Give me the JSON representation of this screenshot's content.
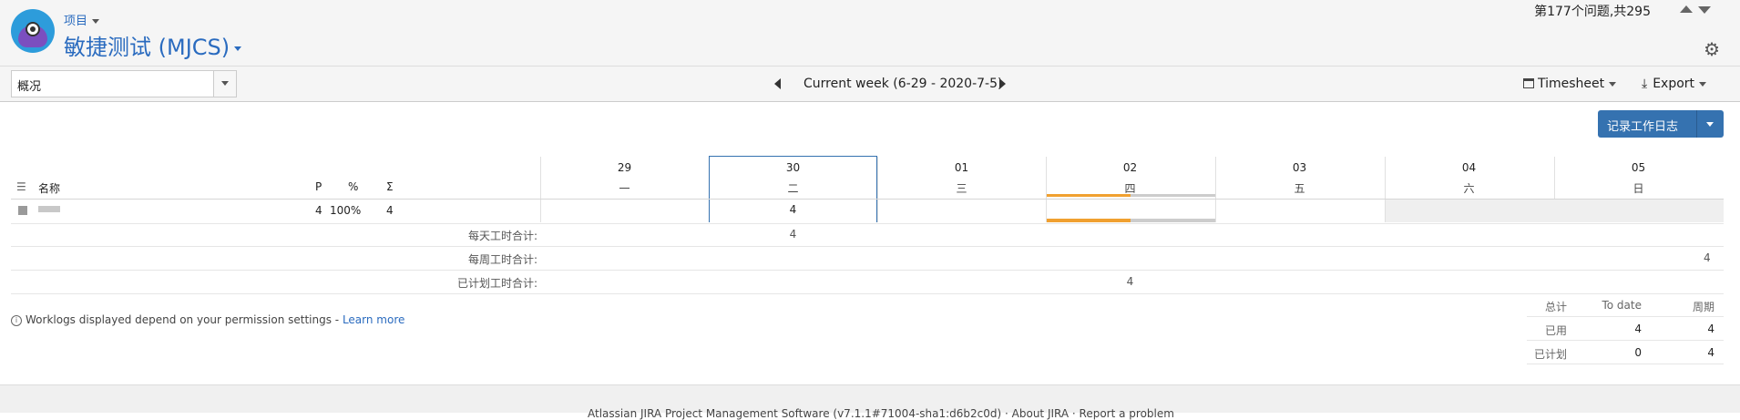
{
  "header": {
    "project_menu_label": "项目",
    "project_title": "敏捷测试 (MJCS)",
    "issue_counter": "第177个问题,共295"
  },
  "toolbar": {
    "view_select_value": "概况",
    "week_label": "Current week (6-29 - 2020-7-5)",
    "timesheet_label": "Timesheet",
    "export_label": "Export"
  },
  "actions": {
    "log_work_label": "记录工作日志"
  },
  "grid": {
    "headers": {
      "name": "名称",
      "p": "P",
      "percent": "%",
      "sigma": "Σ"
    },
    "days": [
      {
        "num": "29",
        "weekday": "一"
      },
      {
        "num": "30",
        "weekday": "二"
      },
      {
        "num": "01",
        "weekday": "三"
      },
      {
        "num": "02",
        "weekday": "四"
      },
      {
        "num": "03",
        "weekday": "五"
      },
      {
        "num": "04",
        "weekday": "六"
      },
      {
        "num": "05",
        "weekday": "日"
      }
    ],
    "row": {
      "p": "4",
      "percent": "100%",
      "sigma": "4",
      "day30": "4"
    },
    "summaries": {
      "daily_label": "每天工时合计:",
      "daily_value": "4",
      "weekly_label": "每周工时合计:",
      "weekly_value": "4",
      "planned_label": "已计划工时合计:",
      "planned_value": "4"
    }
  },
  "footnote": {
    "text": "Worklogs displayed depend on your permission settings - ",
    "link": "Learn more"
  },
  "totals": {
    "headers": [
      "总计",
      "To date",
      "周期"
    ],
    "rows": [
      {
        "label": "已用",
        "to_date": "4",
        "period": "4"
      },
      {
        "label": "已计划",
        "to_date": "0",
        "period": "4"
      }
    ]
  },
  "footer": {
    "text": "Atlassian JIRA Project Management Software (v7.1.1#71004-sha1:d6b2c0d) · About JIRA · Report a problem"
  },
  "colors": {
    "accent": "#3572b0",
    "link": "#2a6bbf",
    "plan_bar": "#f0a030",
    "today_border": "#3572b0"
  }
}
